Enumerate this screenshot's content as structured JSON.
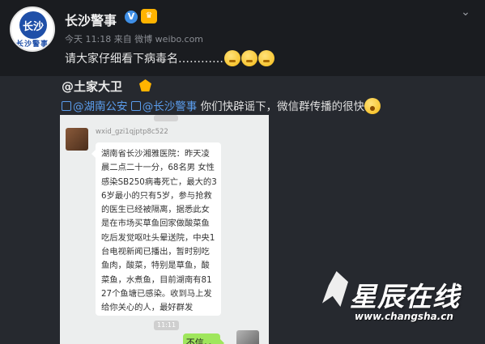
{
  "post": {
    "author": "长沙警事",
    "avatar_badge": "长沙",
    "avatar_caption": "长沙警事",
    "meta": "今天 11:18 来自 微博 weibo.com",
    "text": "请大家仔细看下病毒名…………",
    "more_icon": "chevron-down-icon"
  },
  "repost": {
    "author": "@土家大卫",
    "mention_1": "湖南公安",
    "mention_2": "长沙警事",
    "text": "你们快辟谣下，微信群传播的很快"
  },
  "chat": {
    "sender": "wxid_gzi1qjptp8c522",
    "message": "湖南省长沙湘雅医院：昨天凌晨二点二十一分，68名男 女性感染SB250病毒死亡，最大的36岁最小的只有5岁，参与抢救的医生已经被隔离，据悉此女是在市场买草鱼回家做酸菜鱼吃后发觉呕吐头晕送院，中央1台电视新闻已播出，暂时别吃鱼肉，酸菜，特别是草鱼，酸菜鱼，水煮鱼，目前湖南有8127个鱼塘已感染。收到马上发给你关心的人，最好群发",
    "time": "11:11",
    "reply": "不信。。"
  },
  "watermark": {
    "brand": "星辰在线",
    "url": "www.changsha.cn"
  },
  "colors": {
    "background": "#1d1f24",
    "mention": "#5b9ded",
    "chat_background": "#eceeee",
    "reply_bubble": "#9fe65c"
  }
}
